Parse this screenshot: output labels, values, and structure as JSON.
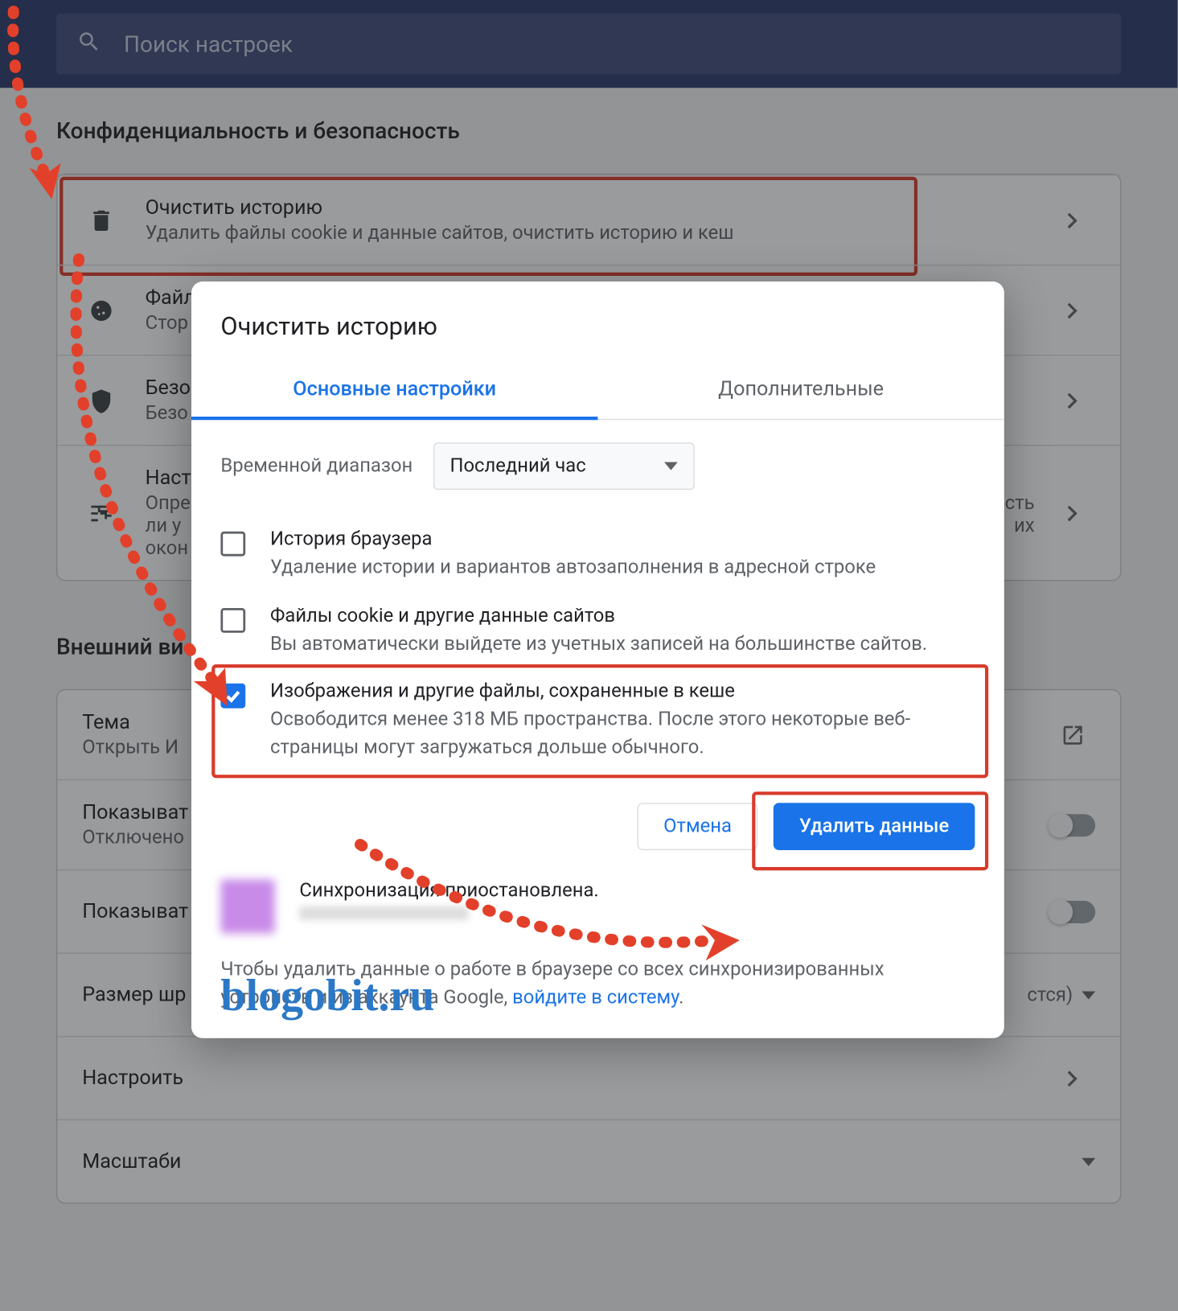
{
  "search": {
    "placeholder": "Поиск настроек"
  },
  "section1": {
    "heading": "Конфиденциальность и безопасность",
    "items": [
      {
        "title": "Очистить историю",
        "sub": "Удалить файлы cookie и данные сайтов, очистить историю и кеш"
      },
      {
        "title": "Файл",
        "sub": "Стор"
      },
      {
        "title": "Безо",
        "sub": "Безо"
      },
      {
        "title": "Наст",
        "sub": "Опре\nли у\nокон",
        "sub2": "сть\nих"
      }
    ]
  },
  "section2": {
    "heading": "Внешний ви",
    "items": [
      {
        "title": "Тема",
        "sub": "Открыть И"
      },
      {
        "title": "Показыват",
        "sub": "Отключено"
      },
      {
        "title": "Показыват"
      },
      {
        "title": "Размер шр",
        "drop": "стся)"
      },
      {
        "title": "Настроить"
      },
      {
        "title": "Масштаби"
      }
    ]
  },
  "dialog": {
    "title": "Очистить историю",
    "tab_basic": "Основные настройки",
    "tab_advanced": "Дополнительные",
    "range_label": "Временной диапазон",
    "range_value": "Последний час",
    "items": [
      {
        "title": "История браузера",
        "sub": "Удаление истории и вариантов автозаполнения в адресной строке",
        "checked": false
      },
      {
        "title": "Файлы cookie и другие данные сайтов",
        "sub": "Вы автоматически выйдете из учетных записей на большинстве сайтов.",
        "checked": false
      },
      {
        "title": "Изображения и другие файлы, сохраненные в кеше",
        "sub": "Освободится менее 318 МБ пространства. После этого некоторые веб-страницы могут загружаться дольше обычного.",
        "checked": true
      }
    ],
    "cancel": "Отмена",
    "confirm": "Удалить данные",
    "sync_title": "Синхронизация приостановлена.",
    "footnote_pre": "Чтобы удалить данные о работе в браузере со всех синхронизированных устройств и из аккаунта Google, ",
    "footnote_link": "войдите в систему",
    "footnote_post": "."
  },
  "watermark": "blogobit.ru"
}
